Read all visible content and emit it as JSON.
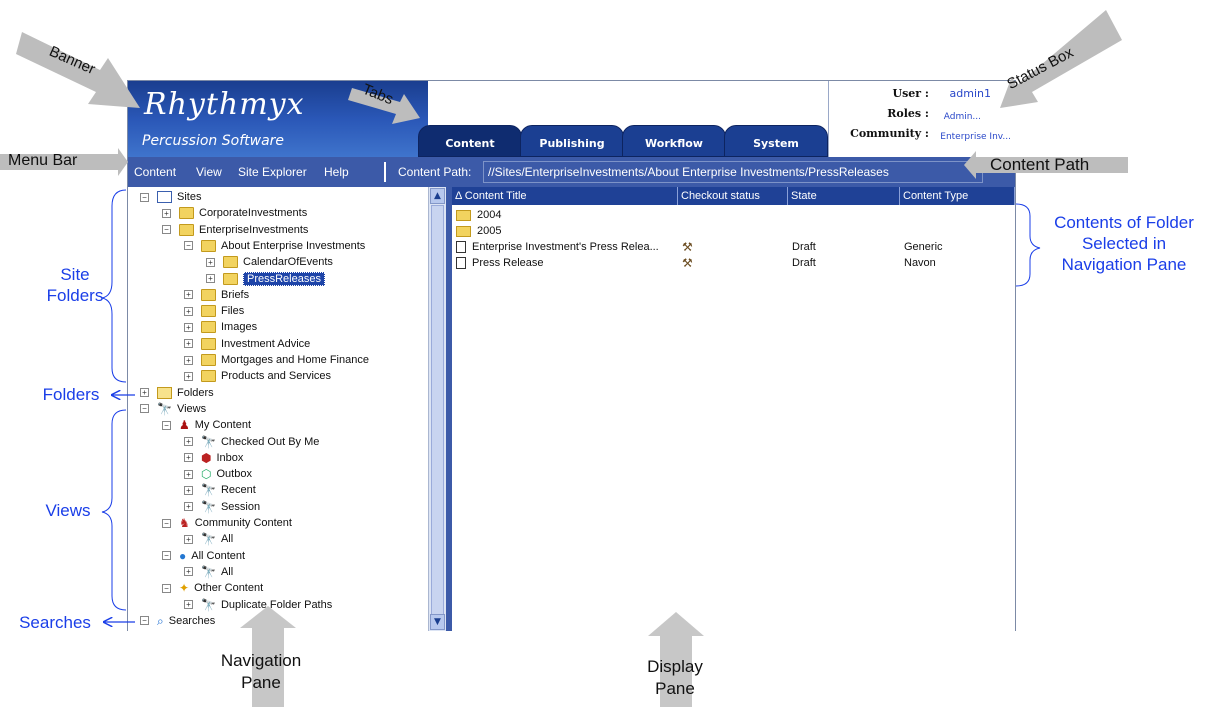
{
  "app": {
    "logo": "Rhythmyx",
    "sublogo": "Percussion Software",
    "tabs": [
      "Content",
      "Publishing",
      "Workflow",
      "System"
    ],
    "active_tab": "Content",
    "status": {
      "user_label": "User :",
      "user_value": "admin1",
      "roles_label": "Roles :",
      "roles_value": "Admin...",
      "community_label": "Community :",
      "community_value": "Enterprise Inv..."
    },
    "menu": [
      "Content",
      "View",
      "Site Explorer",
      "Help"
    ],
    "content_path_label": "Content Path:",
    "content_path_value": "//Sites/EnterpriseInvestments/About Enterprise Investments/PressReleases"
  },
  "nav_tree": [
    {
      "label": "Sites",
      "pm": "−",
      "icon": "sites"
    },
    {
      "label": "CorporateInvestments",
      "pm": "+",
      "icon": "folder"
    },
    {
      "label": "EnterpriseInvestments",
      "pm": "−",
      "icon": "folder"
    },
    {
      "label": "About Enterprise Investments",
      "pm": "−",
      "icon": "folder"
    },
    {
      "label": "CalendarOfEvents",
      "pm": "+",
      "icon": "folder"
    },
    {
      "label": "PressReleases",
      "pm": "+",
      "icon": "folder",
      "selected": true
    },
    {
      "label": "Briefs",
      "pm": "+",
      "icon": "folder"
    },
    {
      "label": "Files",
      "pm": "+",
      "icon": "folder"
    },
    {
      "label": "Images",
      "pm": "+",
      "icon": "folder"
    },
    {
      "label": "Investment Advice",
      "pm": "+",
      "icon": "folder"
    },
    {
      "label": "Mortgages and Home Finance",
      "pm": "+",
      "icon": "folder"
    },
    {
      "label": "Products and Services",
      "pm": "+",
      "icon": "folder"
    },
    {
      "label": "Folders",
      "pm": "+",
      "icon": "folder-open"
    },
    {
      "label": "Views",
      "pm": "−",
      "icon": "binoculars"
    },
    {
      "label": "My Content",
      "pm": "−",
      "icon": "person"
    },
    {
      "label": "Checked Out By Me",
      "pm": "+",
      "icon": "binoculars"
    },
    {
      "label": "Inbox",
      "pm": "+",
      "icon": "inbox"
    },
    {
      "label": "Outbox",
      "pm": "+",
      "icon": "outbox"
    },
    {
      "label": "Recent",
      "pm": "+",
      "icon": "binoculars"
    },
    {
      "label": "Session",
      "pm": "+",
      "icon": "binoculars"
    },
    {
      "label": "Community Content",
      "pm": "−",
      "icon": "people"
    },
    {
      "label": "All",
      "pm": "+",
      "icon": "binoculars"
    },
    {
      "label": "All Content",
      "pm": "−",
      "icon": "globe"
    },
    {
      "label": "All",
      "pm": "+",
      "icon": "binoculars"
    },
    {
      "label": "Other Content",
      "pm": "−",
      "icon": "other"
    },
    {
      "label": "Duplicate Folder Paths",
      "pm": "+",
      "icon": "binoculars"
    },
    {
      "label": "Searches",
      "pm": "−",
      "icon": "magnifier"
    }
  ],
  "table": {
    "columns": [
      "Δ Content Title",
      "Checkout status",
      "State",
      "Content Type"
    ],
    "rows": [
      {
        "title": "2004",
        "type_icon": "folder",
        "checkout": "",
        "state": "",
        "ctype": ""
      },
      {
        "title": "2005",
        "type_icon": "folder",
        "checkout": "",
        "state": "",
        "ctype": ""
      },
      {
        "title": "Enterprise Investment's Press Relea...",
        "type_icon": "doc",
        "checkout": "checked-out-icon",
        "state": "Draft",
        "ctype": "Generic"
      },
      {
        "title": "Press Release",
        "type_icon": "doc",
        "checkout": "checked-out-icon",
        "state": "Draft",
        "ctype": "Navon"
      }
    ]
  },
  "callouts": {
    "banner": "Banner",
    "tabs": "Tabs",
    "status_box": "Status Box",
    "menu_bar": "Menu Bar",
    "content_path": "Content Path",
    "site_folders": "Site\nFolders",
    "folders": "Folders",
    "views": "Views",
    "searches": "Searches",
    "contents_of_folder": "Contents of Folder\nSelected in\nNavigation Pane",
    "navigation_pane": "Navigation\nPane",
    "display_pane": "Display\nPane"
  },
  "colors": {
    "banner_dark": "#1a3e8f",
    "menubar": "#3c5aa8",
    "callout_blue": "#1a3ee8",
    "arrow_gray": "#bdbdbd"
  }
}
